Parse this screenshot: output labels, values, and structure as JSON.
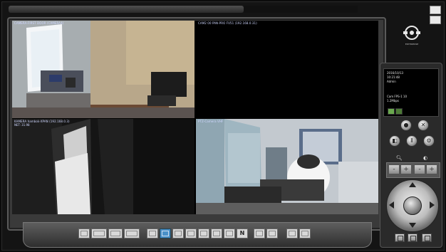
{
  "cameras": [
    {
      "title": "CAMERA-FIRST DOOR (CAMERA4)",
      "sub": ""
    },
    {
      "title": "CAM2 00 PAN-PRO FV51 (192.168.0.31)",
      "sub": ""
    },
    {
      "title": "KAMERA hambok-XPAN (192.168.0.3)",
      "sub": "NET: 31.98"
    },
    {
      "title": "PTZ-Camera VHF",
      "sub": ""
    }
  ],
  "info": {
    "date": "2016/10/13",
    "time": "10:21:48",
    "mode": "Admin",
    "cam": "Cam FPS-1 10",
    "rate": "1.2Mbps"
  },
  "logo_text": "ENTERPRISE",
  "toolbar": {
    "n_label": "N",
    "active_layout": "2x2"
  },
  "zoom": {
    "zoom_icon": "magnifier-icon",
    "focus_icon": "focus-icon",
    "minus": "-",
    "plus": "+"
  },
  "colors": {
    "active_button": "#4a90c8",
    "status_green": "#6aa84f"
  }
}
